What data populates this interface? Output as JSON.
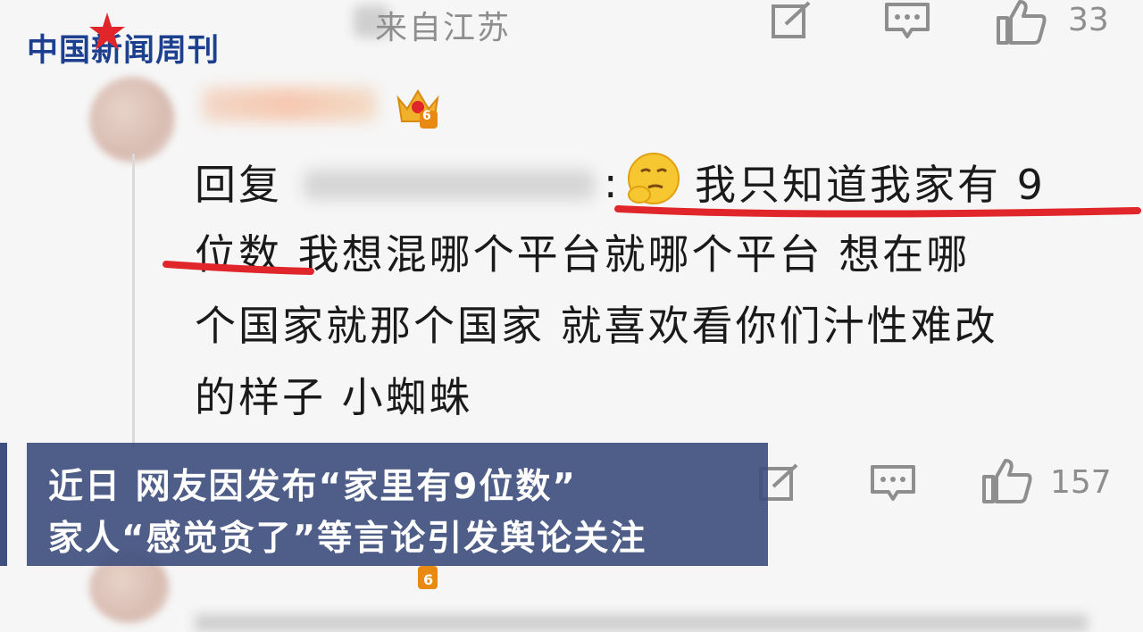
{
  "header": {
    "location": "来自江苏",
    "like_count": "33"
  },
  "logo": {
    "text": "中国新闻周刊"
  },
  "badge": {
    "level": "6"
  },
  "comment": {
    "reply_prefix": "回复",
    "colon": ":",
    "line1": "我只知道我家有 9",
    "line2_underlined": "位数",
    "line2_rest": " 我想混哪个平台就哪个平台 想在哪",
    "line3": "个国家就那个国家 就喜欢看你们汁性难改",
    "line4": "的样子 小蜘蛛"
  },
  "second_row": {
    "like_count": "157",
    "badge_level": "6"
  },
  "caption": {
    "line1": "近日 网友因发布“家里有9位数”",
    "line2": "家人“感觉贪了”等言论引发舆论关注"
  },
  "colors": {
    "caption_bg": "#40507e",
    "underline": "#e0262a",
    "logo_blue": "#1d3f8f",
    "logo_red": "#e0262a",
    "meta_gray": "#8e8e8e"
  }
}
